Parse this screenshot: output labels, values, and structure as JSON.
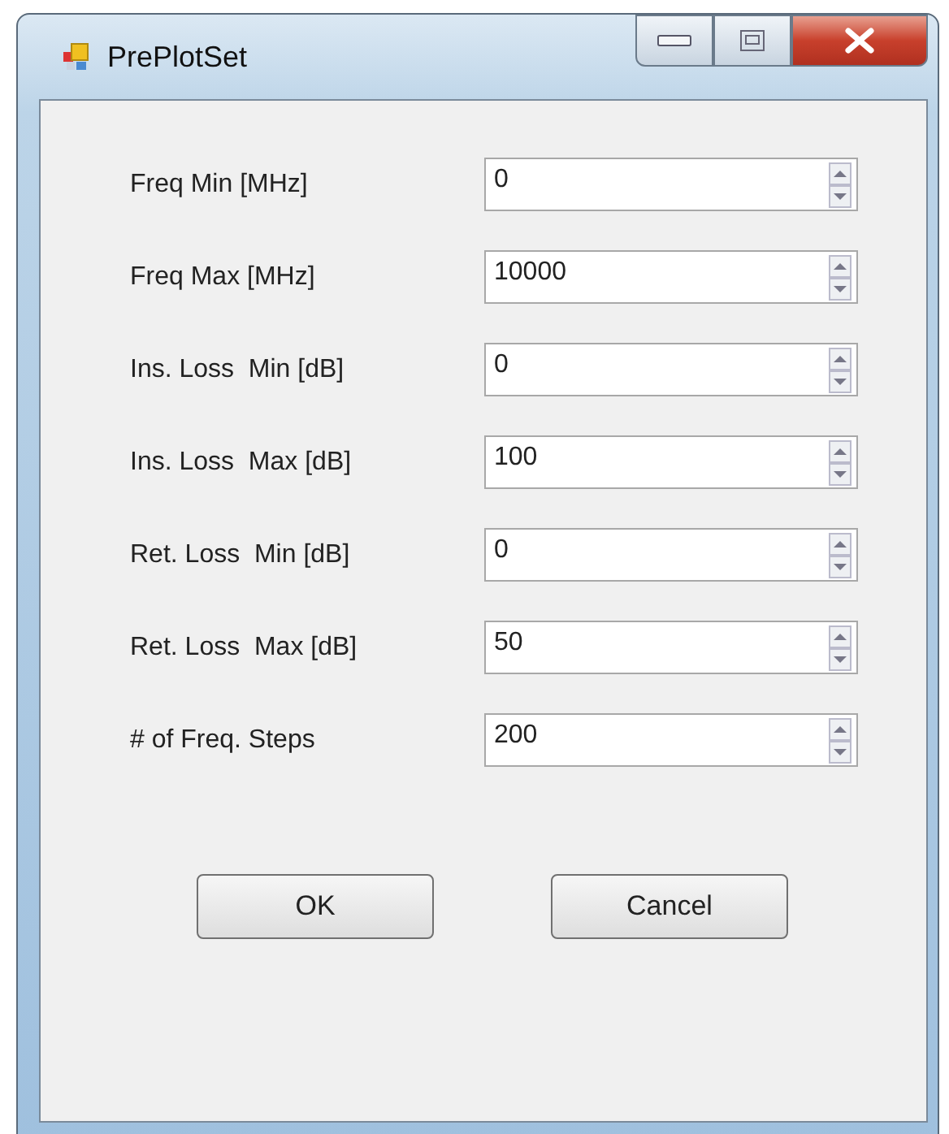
{
  "window": {
    "title": "PrePlotSet"
  },
  "fields": [
    {
      "label": "Freq Min [MHz]",
      "value": "0"
    },
    {
      "label": "Freq Max [MHz]",
      "value": "10000"
    },
    {
      "label": "Ins. Loss  Min [dB]",
      "value": "0"
    },
    {
      "label": "Ins. Loss  Max [dB]",
      "value": "100"
    },
    {
      "label": "Ret. Loss  Min [dB]",
      "value": "0"
    },
    {
      "label": "Ret. Loss  Max [dB]",
      "value": "50"
    },
    {
      "label": "# of Freq. Steps",
      "value": "200"
    }
  ],
  "buttons": [
    "OK",
    "Cancel"
  ]
}
